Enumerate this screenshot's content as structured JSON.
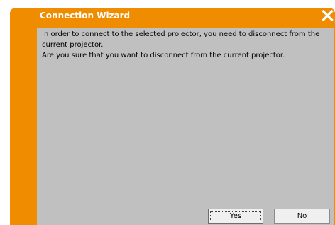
{
  "window": {
    "title": "Connection Wizard",
    "close_icon": "close-icon",
    "accent_color": "#f08c00"
  },
  "message": {
    "lines": [
      "In order to connect to the selected projector, you need to disconnect from the current projector.",
      "Are you sure that you want to disconnect from the current projector."
    ]
  },
  "buttons": {
    "yes_label": "Yes",
    "no_label": "No"
  }
}
